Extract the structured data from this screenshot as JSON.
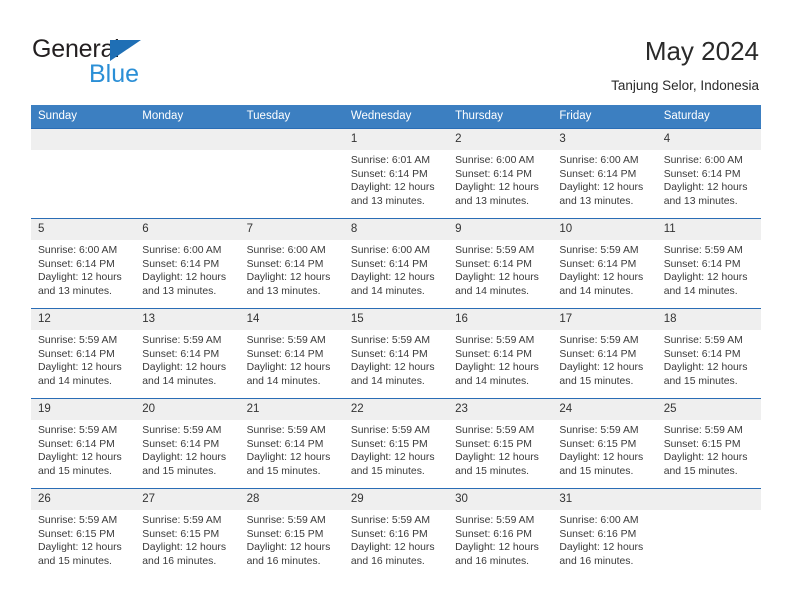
{
  "brand": {
    "name_top": "General",
    "name_bottom": "Blue",
    "triangle_color": "#1f6fb5",
    "text_color": "#231f20",
    "blue_text_color": "#2b8fd6"
  },
  "header": {
    "title": "May 2024",
    "subtitle": "Tanjung Selor, Indonesia"
  },
  "theme": {
    "header_bg": "#3c7fc1",
    "row_border": "#2a6db5",
    "daynum_bg": "#efefef",
    "page_bg": "#ffffff",
    "text": "#3a3a3a"
  },
  "calendar": {
    "weekday_headers": [
      "Sunday",
      "Monday",
      "Tuesday",
      "Wednesday",
      "Thursday",
      "Friday",
      "Saturday"
    ],
    "weeks": [
      [
        {
          "day": "",
          "empty": true,
          "sunrise": "",
          "sunset": "",
          "daylight_line1": "",
          "daylight_line2": ""
        },
        {
          "day": "",
          "empty": true,
          "sunrise": "",
          "sunset": "",
          "daylight_line1": "",
          "daylight_line2": ""
        },
        {
          "day": "",
          "empty": true,
          "sunrise": "",
          "sunset": "",
          "daylight_line1": "",
          "daylight_line2": ""
        },
        {
          "day": "1",
          "empty": false,
          "sunrise": "Sunrise: 6:01 AM",
          "sunset": "Sunset: 6:14 PM",
          "daylight_line1": "Daylight: 12 hours",
          "daylight_line2": "and 13 minutes."
        },
        {
          "day": "2",
          "empty": false,
          "sunrise": "Sunrise: 6:00 AM",
          "sunset": "Sunset: 6:14 PM",
          "daylight_line1": "Daylight: 12 hours",
          "daylight_line2": "and 13 minutes."
        },
        {
          "day": "3",
          "empty": false,
          "sunrise": "Sunrise: 6:00 AM",
          "sunset": "Sunset: 6:14 PM",
          "daylight_line1": "Daylight: 12 hours",
          "daylight_line2": "and 13 minutes."
        },
        {
          "day": "4",
          "empty": false,
          "sunrise": "Sunrise: 6:00 AM",
          "sunset": "Sunset: 6:14 PM",
          "daylight_line1": "Daylight: 12 hours",
          "daylight_line2": "and 13 minutes."
        }
      ],
      [
        {
          "day": "5",
          "empty": false,
          "sunrise": "Sunrise: 6:00 AM",
          "sunset": "Sunset: 6:14 PM",
          "daylight_line1": "Daylight: 12 hours",
          "daylight_line2": "and 13 minutes."
        },
        {
          "day": "6",
          "empty": false,
          "sunrise": "Sunrise: 6:00 AM",
          "sunset": "Sunset: 6:14 PM",
          "daylight_line1": "Daylight: 12 hours",
          "daylight_line2": "and 13 minutes."
        },
        {
          "day": "7",
          "empty": false,
          "sunrise": "Sunrise: 6:00 AM",
          "sunset": "Sunset: 6:14 PM",
          "daylight_line1": "Daylight: 12 hours",
          "daylight_line2": "and 13 minutes."
        },
        {
          "day": "8",
          "empty": false,
          "sunrise": "Sunrise: 6:00 AM",
          "sunset": "Sunset: 6:14 PM",
          "daylight_line1": "Daylight: 12 hours",
          "daylight_line2": "and 14 minutes."
        },
        {
          "day": "9",
          "empty": false,
          "sunrise": "Sunrise: 5:59 AM",
          "sunset": "Sunset: 6:14 PM",
          "daylight_line1": "Daylight: 12 hours",
          "daylight_line2": "and 14 minutes."
        },
        {
          "day": "10",
          "empty": false,
          "sunrise": "Sunrise: 5:59 AM",
          "sunset": "Sunset: 6:14 PM",
          "daylight_line1": "Daylight: 12 hours",
          "daylight_line2": "and 14 minutes."
        },
        {
          "day": "11",
          "empty": false,
          "sunrise": "Sunrise: 5:59 AM",
          "sunset": "Sunset: 6:14 PM",
          "daylight_line1": "Daylight: 12 hours",
          "daylight_line2": "and 14 minutes."
        }
      ],
      [
        {
          "day": "12",
          "empty": false,
          "sunrise": "Sunrise: 5:59 AM",
          "sunset": "Sunset: 6:14 PM",
          "daylight_line1": "Daylight: 12 hours",
          "daylight_line2": "and 14 minutes."
        },
        {
          "day": "13",
          "empty": false,
          "sunrise": "Sunrise: 5:59 AM",
          "sunset": "Sunset: 6:14 PM",
          "daylight_line1": "Daylight: 12 hours",
          "daylight_line2": "and 14 minutes."
        },
        {
          "day": "14",
          "empty": false,
          "sunrise": "Sunrise: 5:59 AM",
          "sunset": "Sunset: 6:14 PM",
          "daylight_line1": "Daylight: 12 hours",
          "daylight_line2": "and 14 minutes."
        },
        {
          "day": "15",
          "empty": false,
          "sunrise": "Sunrise: 5:59 AM",
          "sunset": "Sunset: 6:14 PM",
          "daylight_line1": "Daylight: 12 hours",
          "daylight_line2": "and 14 minutes."
        },
        {
          "day": "16",
          "empty": false,
          "sunrise": "Sunrise: 5:59 AM",
          "sunset": "Sunset: 6:14 PM",
          "daylight_line1": "Daylight: 12 hours",
          "daylight_line2": "and 14 minutes."
        },
        {
          "day": "17",
          "empty": false,
          "sunrise": "Sunrise: 5:59 AM",
          "sunset": "Sunset: 6:14 PM",
          "daylight_line1": "Daylight: 12 hours",
          "daylight_line2": "and 15 minutes."
        },
        {
          "day": "18",
          "empty": false,
          "sunrise": "Sunrise: 5:59 AM",
          "sunset": "Sunset: 6:14 PM",
          "daylight_line1": "Daylight: 12 hours",
          "daylight_line2": "and 15 minutes."
        }
      ],
      [
        {
          "day": "19",
          "empty": false,
          "sunrise": "Sunrise: 5:59 AM",
          "sunset": "Sunset: 6:14 PM",
          "daylight_line1": "Daylight: 12 hours",
          "daylight_line2": "and 15 minutes."
        },
        {
          "day": "20",
          "empty": false,
          "sunrise": "Sunrise: 5:59 AM",
          "sunset": "Sunset: 6:14 PM",
          "daylight_line1": "Daylight: 12 hours",
          "daylight_line2": "and 15 minutes."
        },
        {
          "day": "21",
          "empty": false,
          "sunrise": "Sunrise: 5:59 AM",
          "sunset": "Sunset: 6:14 PM",
          "daylight_line1": "Daylight: 12 hours",
          "daylight_line2": "and 15 minutes."
        },
        {
          "day": "22",
          "empty": false,
          "sunrise": "Sunrise: 5:59 AM",
          "sunset": "Sunset: 6:15 PM",
          "daylight_line1": "Daylight: 12 hours",
          "daylight_line2": "and 15 minutes."
        },
        {
          "day": "23",
          "empty": false,
          "sunrise": "Sunrise: 5:59 AM",
          "sunset": "Sunset: 6:15 PM",
          "daylight_line1": "Daylight: 12 hours",
          "daylight_line2": "and 15 minutes."
        },
        {
          "day": "24",
          "empty": false,
          "sunrise": "Sunrise: 5:59 AM",
          "sunset": "Sunset: 6:15 PM",
          "daylight_line1": "Daylight: 12 hours",
          "daylight_line2": "and 15 minutes."
        },
        {
          "day": "25",
          "empty": false,
          "sunrise": "Sunrise: 5:59 AM",
          "sunset": "Sunset: 6:15 PM",
          "daylight_line1": "Daylight: 12 hours",
          "daylight_line2": "and 15 minutes."
        }
      ],
      [
        {
          "day": "26",
          "empty": false,
          "sunrise": "Sunrise: 5:59 AM",
          "sunset": "Sunset: 6:15 PM",
          "daylight_line1": "Daylight: 12 hours",
          "daylight_line2": "and 15 minutes."
        },
        {
          "day": "27",
          "empty": false,
          "sunrise": "Sunrise: 5:59 AM",
          "sunset": "Sunset: 6:15 PM",
          "daylight_line1": "Daylight: 12 hours",
          "daylight_line2": "and 16 minutes."
        },
        {
          "day": "28",
          "empty": false,
          "sunrise": "Sunrise: 5:59 AM",
          "sunset": "Sunset: 6:15 PM",
          "daylight_line1": "Daylight: 12 hours",
          "daylight_line2": "and 16 minutes."
        },
        {
          "day": "29",
          "empty": false,
          "sunrise": "Sunrise: 5:59 AM",
          "sunset": "Sunset: 6:16 PM",
          "daylight_line1": "Daylight: 12 hours",
          "daylight_line2": "and 16 minutes."
        },
        {
          "day": "30",
          "empty": false,
          "sunrise": "Sunrise: 5:59 AM",
          "sunset": "Sunset: 6:16 PM",
          "daylight_line1": "Daylight: 12 hours",
          "daylight_line2": "and 16 minutes."
        },
        {
          "day": "31",
          "empty": false,
          "sunrise": "Sunrise: 6:00 AM",
          "sunset": "Sunset: 6:16 PM",
          "daylight_line1": "Daylight: 12 hours",
          "daylight_line2": "and 16 minutes."
        },
        {
          "day": "",
          "empty": true,
          "sunrise": "",
          "sunset": "",
          "daylight_line1": "",
          "daylight_line2": ""
        }
      ]
    ]
  }
}
